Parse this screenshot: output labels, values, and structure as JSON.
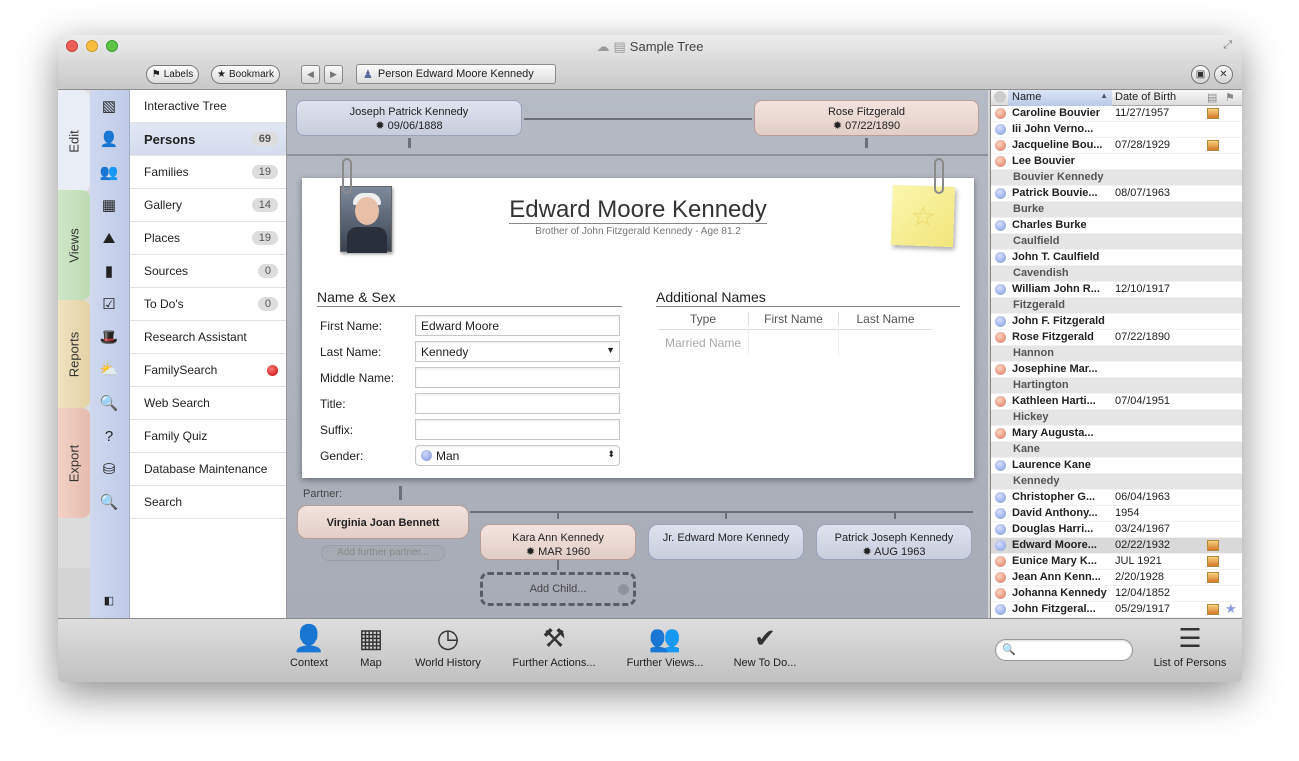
{
  "window": {
    "title": "Sample Tree"
  },
  "toolbar": {
    "labels_btn": "Labels",
    "bookmark_btn": "Bookmark",
    "breadcrumb": "Person Edward Moore Kennedy"
  },
  "tabs": [
    "Edit",
    "Views",
    "Reports",
    "Export"
  ],
  "sidebar": {
    "items": [
      {
        "label": "Interactive Tree",
        "count": ""
      },
      {
        "label": "Persons",
        "count": "69"
      },
      {
        "label": "Families",
        "count": "19"
      },
      {
        "label": "Gallery",
        "count": "14"
      },
      {
        "label": "Places",
        "count": "19"
      },
      {
        "label": "Sources",
        "count": "0"
      },
      {
        "label": "To Do's",
        "count": "0"
      },
      {
        "label": "Research Assistant",
        "count": ""
      },
      {
        "label": "FamilySearch",
        "count": ""
      },
      {
        "label": "Web Search",
        "count": ""
      },
      {
        "label": "Family Quiz",
        "count": ""
      },
      {
        "label": "Database Maintenance",
        "count": ""
      },
      {
        "label": "Search",
        "count": ""
      }
    ]
  },
  "parents": {
    "father": {
      "name": "Joseph Patrick Kennedy",
      "date": "✹ 09/06/1888"
    },
    "mother": {
      "name": "Rose Fitzgerald",
      "date": "✹ 07/22/1890"
    }
  },
  "person": {
    "name": "Edward Moore Kennedy",
    "subtitle": "Brother of John Fitzgerald Kennedy - Age 81.2"
  },
  "name_sex": {
    "title": "Name & Sex",
    "first_name_label": "First Name:",
    "first_name": "Edward Moore",
    "last_name_label": "Last Name:",
    "last_name": "Kennedy",
    "middle_name_label": "Middle Name:",
    "title_label": "Title:",
    "suffix_label": "Suffix:",
    "gender_label": "Gender:",
    "gender": "Man"
  },
  "additional_names": {
    "title": "Additional Names",
    "col_type": "Type",
    "col_first": "First Name",
    "col_last": "Last Name",
    "row_type": "Married Name"
  },
  "partner": {
    "label": "Partner:",
    "name": "Virginia Joan Bennett",
    "add_further": "Add further partner..."
  },
  "children": [
    {
      "name": "Kara Ann Kennedy",
      "date": "✹ MAR 1960"
    },
    {
      "name": "Jr. Edward More Kennedy",
      "date": ""
    },
    {
      "name": "Patrick Joseph Kennedy",
      "date": "✹ AUG 1963"
    }
  ],
  "add_child": "Add Child...",
  "person_list": {
    "col_name": "Name",
    "col_dob": "Date of Birth",
    "rows": [
      {
        "type": "p",
        "sex": "f",
        "name": "Caroline Bouvier",
        "dob": "11/27/1957",
        "photo": true
      },
      {
        "type": "p",
        "sex": "m",
        "name": "Iii John Verno...",
        "dob": "",
        "photo": false
      },
      {
        "type": "p",
        "sex": "f",
        "name": "Jacqueline Bou...",
        "dob": "07/28/1929",
        "photo": true
      },
      {
        "type": "p",
        "sex": "f",
        "name": "Lee Bouvier",
        "dob": "",
        "photo": false
      },
      {
        "type": "g",
        "name": "Bouvier Kennedy"
      },
      {
        "type": "p",
        "sex": "m",
        "name": "Patrick Bouvie...",
        "dob": "08/07/1963",
        "photo": false
      },
      {
        "type": "g",
        "name": "Burke"
      },
      {
        "type": "p",
        "sex": "m",
        "name": "Charles Burke",
        "dob": "",
        "photo": false
      },
      {
        "type": "g",
        "name": "Caulfield"
      },
      {
        "type": "p",
        "sex": "m",
        "name": "John T. Caulfield",
        "dob": "",
        "photo": false
      },
      {
        "type": "g",
        "name": "Cavendish"
      },
      {
        "type": "p",
        "sex": "m",
        "name": "William John R...",
        "dob": "12/10/1917",
        "photo": false
      },
      {
        "type": "g",
        "name": "Fitzgerald"
      },
      {
        "type": "p",
        "sex": "m",
        "name": "John F. Fitzgerald",
        "dob": "",
        "photo": false
      },
      {
        "type": "p",
        "sex": "f",
        "name": "Rose Fitzgerald",
        "dob": "07/22/1890",
        "photo": false
      },
      {
        "type": "g",
        "name": "Hannon"
      },
      {
        "type": "p",
        "sex": "f",
        "name": "Josephine Mar...",
        "dob": "",
        "photo": false
      },
      {
        "type": "g",
        "name": "Hartington"
      },
      {
        "type": "p",
        "sex": "f",
        "name": "Kathleen Harti...",
        "dob": "07/04/1951",
        "photo": false
      },
      {
        "type": "g",
        "name": "Hickey"
      },
      {
        "type": "p",
        "sex": "f",
        "name": "Mary Augusta...",
        "dob": "",
        "photo": false
      },
      {
        "type": "g",
        "name": "Kane"
      },
      {
        "type": "p",
        "sex": "m",
        "name": "Laurence Kane",
        "dob": "",
        "photo": false
      },
      {
        "type": "g",
        "name": "Kennedy"
      },
      {
        "type": "p",
        "sex": "m",
        "name": "Christopher G...",
        "dob": "06/04/1963",
        "photo": false
      },
      {
        "type": "p",
        "sex": "m",
        "name": "David Anthony...",
        "dob": "1954",
        "photo": false
      },
      {
        "type": "p",
        "sex": "m",
        "name": "Douglas Harri...",
        "dob": "03/24/1967",
        "photo": false
      },
      {
        "type": "p",
        "sex": "m",
        "name": "Edward Moore...",
        "dob": "02/22/1932",
        "photo": true,
        "selected": true
      },
      {
        "type": "p",
        "sex": "f",
        "name": "Eunice Mary K...",
        "dob": "JUL 1921",
        "photo": true
      },
      {
        "type": "p",
        "sex": "f",
        "name": "Jean Ann Kenn...",
        "dob": "2/20/1928",
        "photo": true
      },
      {
        "type": "p",
        "sex": "f",
        "name": "Johanna Kennedy",
        "dob": "12/04/1852",
        "photo": false
      },
      {
        "type": "p",
        "sex": "m",
        "name": "John Fitzgeral...",
        "dob": "05/29/1917",
        "photo": true,
        "star": true
      }
    ]
  },
  "bottom_tools": {
    "context": "Context",
    "map": "Map",
    "world_history": "World History",
    "further_actions": "Further Actions...",
    "further_views": "Further Views...",
    "new_todo": "New To Do...",
    "list_of_persons": "List of Persons"
  }
}
